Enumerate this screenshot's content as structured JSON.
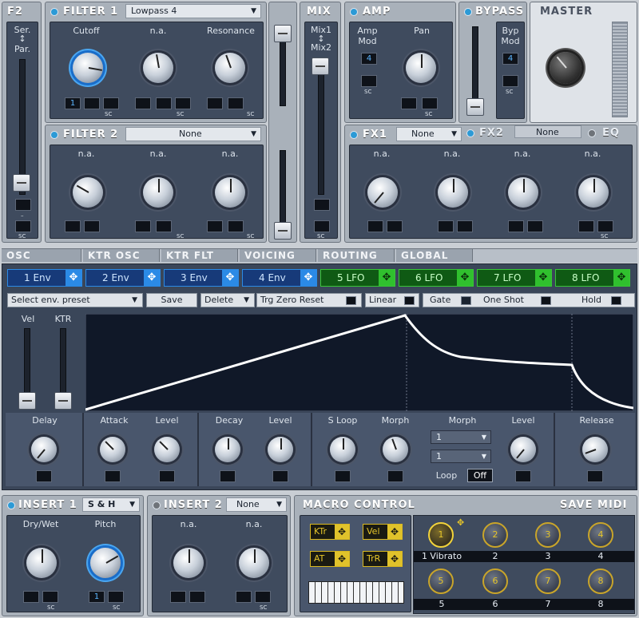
{
  "f2": {
    "title": "F2",
    "ser": "Ser.",
    "par": "Par.",
    "arrow": "↕",
    "sc": "SC",
    "dash": "–"
  },
  "filter1": {
    "title": "FILTER 1",
    "type": "Lowpass 4",
    "knobs": [
      "Cutoff",
      "n.a.",
      "Resonance"
    ],
    "mod_value": "1",
    "dash": "–",
    "sc": "SC"
  },
  "filter2": {
    "title": "FILTER 2",
    "type": "None",
    "knobs": [
      "n.a.",
      "n.a.",
      "n.a."
    ],
    "dash": "–",
    "sc": "SC"
  },
  "mix": {
    "title": "MIX",
    "mix1": "Mix1",
    "mix2": "Mix2",
    "arrow": "↕",
    "sc": "SC"
  },
  "amp": {
    "title": "AMP",
    "amp_mod_1": "Amp",
    "amp_mod_2": "Mod",
    "amp_mod_value": "4",
    "pan": "Pan",
    "sc": "SC",
    "dash": "–"
  },
  "bypass": {
    "title": "BYPASS",
    "byp_1": "Byp",
    "byp_2": "Mod",
    "byp_value": "4",
    "sc": "SC"
  },
  "master": {
    "title": "MASTER"
  },
  "fx": {
    "fx1": "FX1",
    "fx1_type": "None",
    "fx2": "FX2",
    "fx2_type": "None",
    "eq": "EQ",
    "knobs": [
      "n.a.",
      "n.a.",
      "n.a.",
      "n.a."
    ],
    "dash": "–",
    "sc": "SC"
  },
  "tabs": [
    "OSC",
    "KTR OSC",
    "KTR FLT",
    "VOICING",
    "ROUTING",
    "GLOBAL"
  ],
  "mods": [
    {
      "label": "1 Env",
      "kind": "env"
    },
    {
      "label": "2 Env",
      "kind": "env"
    },
    {
      "label": "3 Env",
      "kind": "env"
    },
    {
      "label": "4 Env",
      "kind": "env"
    },
    {
      "label": "5 LFO",
      "kind": "lfo"
    },
    {
      "label": "6 LFO",
      "kind": "lfo"
    },
    {
      "label": "7 LFO",
      "kind": "lfo"
    },
    {
      "label": "8 LFO",
      "kind": "lfo"
    }
  ],
  "env_toolbar": {
    "preset": "Select env. preset",
    "save": "Save",
    "delete": "Delete",
    "trg_zero_reset": "Trg Zero Reset",
    "linear": "Linear",
    "gate": "Gate",
    "one_shot": "One Shot",
    "hold": "Hold"
  },
  "env_side": {
    "vel": "Vel",
    "ktr": "KTR"
  },
  "env_knobs": {
    "delay": "Delay",
    "attack": "Attack",
    "level1": "Level",
    "decay": "Decay",
    "level2": "Level",
    "s_loop": "S Loop",
    "morph1": "Morph",
    "morph2": "Morph",
    "level3": "Level",
    "release": "Release",
    "morph_dd1": "1",
    "morph_dd2": "1",
    "loop": "Loop",
    "loop_value": "Off"
  },
  "insert1": {
    "title": "INSERT 1",
    "type": "S & H",
    "knobs": [
      "Dry/Wet",
      "Pitch"
    ],
    "mod_value": "1",
    "dash": "–",
    "sc": "SC"
  },
  "insert2": {
    "title": "INSERT 2",
    "type": "None",
    "knobs": [
      "n.a.",
      "n.a."
    ],
    "dash": "–",
    "sc": "SC"
  },
  "macro": {
    "title": "MACRO CONTROL",
    "save_midi": "SAVE MIDI",
    "buttons": [
      "KTr",
      "Vel",
      "AT",
      "TrR"
    ],
    "knobs": [
      {
        "num": "1",
        "label": "1 Vibrato"
      },
      {
        "num": "2",
        "label": "2"
      },
      {
        "num": "3",
        "label": "3"
      },
      {
        "num": "4",
        "label": "4"
      },
      {
        "num": "5",
        "label": "5"
      },
      {
        "num": "6",
        "label": "6"
      },
      {
        "num": "7",
        "label": "7"
      },
      {
        "num": "8",
        "label": "8"
      }
    ]
  },
  "colors": {
    "env_blue": "#2b8ae6",
    "lfo_green": "#38c636",
    "macro_yellow": "#e0c22b",
    "led_blue": "#2c9ad6"
  }
}
